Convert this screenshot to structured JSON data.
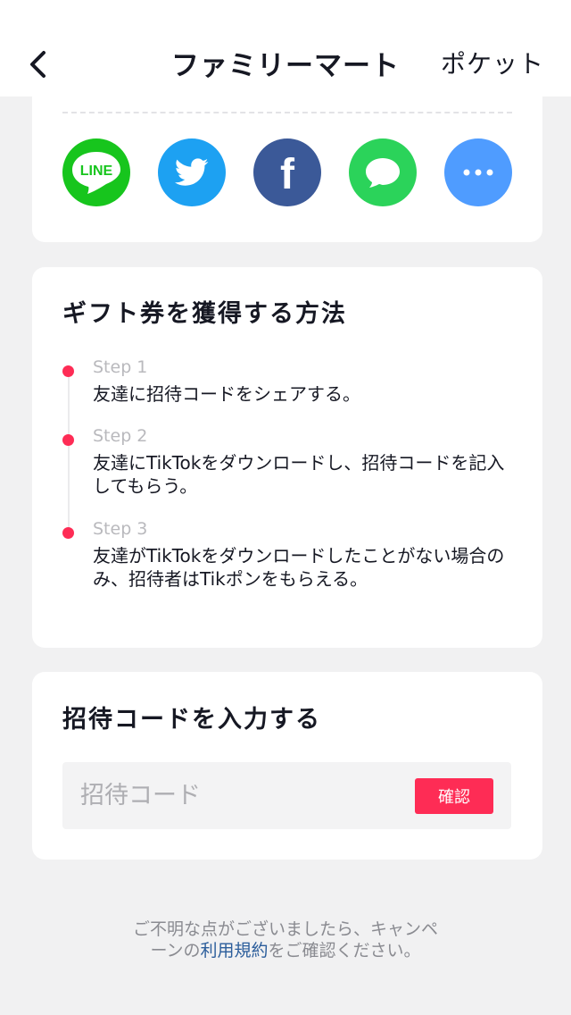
{
  "header": {
    "title": "ファミリーマート",
    "right_label": "ポケット"
  },
  "share": {
    "buttons": [
      {
        "name": "LINE",
        "label": "LINE",
        "color": "#17c51d"
      },
      {
        "name": "Twitter",
        "color": "#1da1f2"
      },
      {
        "name": "Facebook",
        "label": "f",
        "color": "#3b5998"
      },
      {
        "name": "Message",
        "color": "#2bd35a"
      },
      {
        "name": "More",
        "color": "#4f9cff"
      }
    ]
  },
  "steps_card": {
    "title": "ギフト券を獲得する方法",
    "steps": [
      {
        "label": "Step 1",
        "text": "友達に招待コードをシェアする。"
      },
      {
        "label": "Step 2",
        "text": "友達にTikTokをダウンロードし、招待コードを記入してもらう。"
      },
      {
        "label": "Step 3",
        "text": "友達がTikTokをダウンロードしたことがない場合のみ、招待者はTikポンをもらえる。"
      }
    ]
  },
  "code_card": {
    "title": "招待コードを入力する",
    "input_value": "",
    "input_placeholder": "招待コード",
    "confirm_label": "確認"
  },
  "footer": {
    "text_before": "ご不明な点がございましたら、キャンペーンの",
    "link_text": "利用規約",
    "text_after": "をご確認ください。"
  },
  "colors": {
    "accent": "#fe2c55",
    "link": "#2b5d9b"
  }
}
